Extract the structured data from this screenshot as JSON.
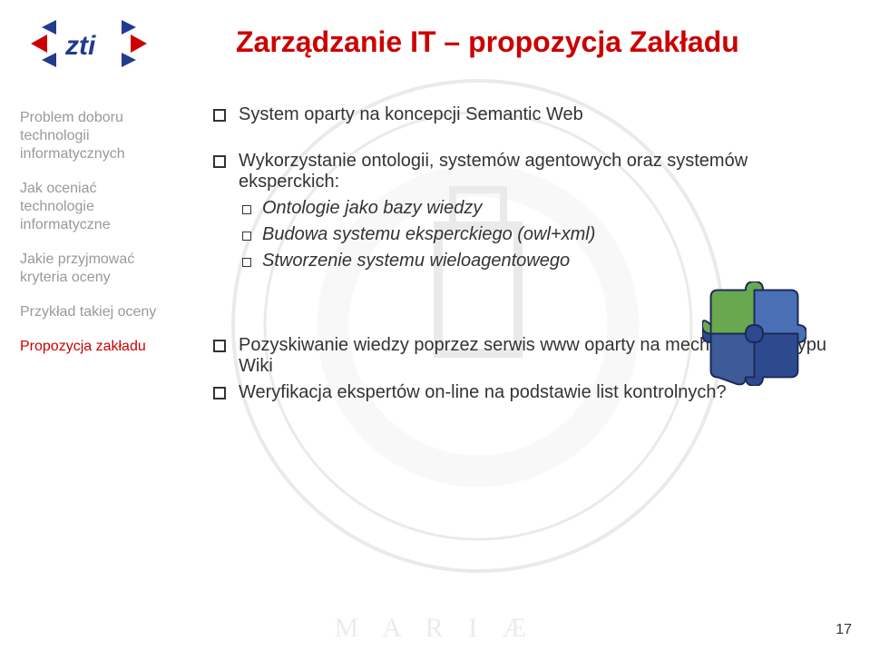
{
  "title": "Zarządzanie IT – propozycja Zakładu",
  "logo_text": "zti",
  "sidebar": {
    "items": [
      {
        "lines": [
          "Problem doboru",
          "technologii",
          "informatycznych"
        ],
        "active": false
      },
      {
        "lines": [
          "Jak oceniać",
          "technologie",
          "informatyczne"
        ],
        "active": false
      },
      {
        "lines": [
          "Jakie przyjmować",
          "kryteria oceny"
        ],
        "active": false
      },
      {
        "lines": [
          "Przykład takiej oceny"
        ],
        "active": false
      },
      {
        "lines": [
          "Propozycja zakładu"
        ],
        "active": true
      }
    ]
  },
  "content": {
    "b1": "System oparty na koncepcji Semantic Web",
    "b2": "Wykorzystanie ontologii, systemów agentowych oraz systemów eksperckich:",
    "b2a": "Ontologie jako bazy wiedzy",
    "b2b": "Budowa systemu eksperckiego (owl+xml)",
    "b2c": "Stworzenie systemu wieloagentowego",
    "b3": "Pozyskiwanie wiedzy poprzez serwis www oparty na mechanizmach typu Wiki",
    "b4": "Weryfikacja ekspertów on-line na podstawie list kontrolnych?"
  },
  "page_number": "17",
  "watermark_text": "M A R I Æ"
}
